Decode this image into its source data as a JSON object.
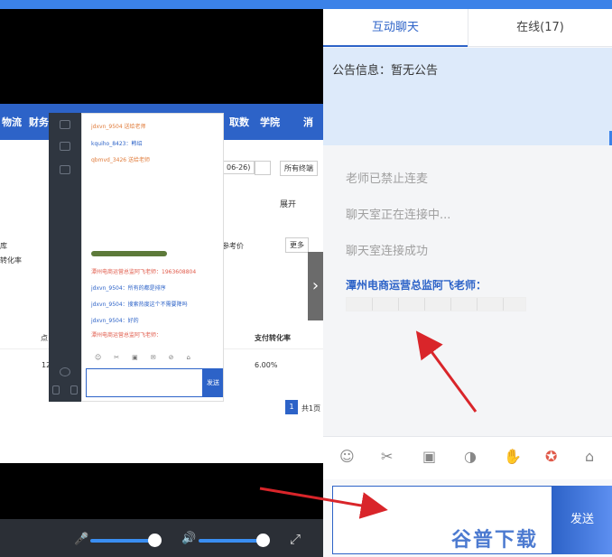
{
  "chat": {
    "tabs": [
      "互动聊天",
      "在线(17)"
    ],
    "notice": "公告信息：暂无公告",
    "system_messages": [
      "老师已禁止连麦",
      "聊天室正在连接中...",
      "聊天室连接成功"
    ],
    "teacher_name": "潭州电商运营总监阿飞老师：",
    "send_label": "发送",
    "tool_icons": [
      "emoji-icon",
      "scissors-icon",
      "image-icon",
      "mic-request-icon",
      "hand-icon",
      "award-icon",
      "gift-icon"
    ]
  },
  "shared_screen": {
    "nav_items": [
      "物流",
      "财务",
      "取数",
      "学院",
      "消"
    ],
    "date_text": "06-26)",
    "terminal_select": "所有终端",
    "expand_label": "展开",
    "more_label": "更多",
    "ref_price_label": "参考价",
    "left_labels": [
      "库",
      "转化率"
    ],
    "col_pay_rate": "支付转化率",
    "col_click": "点",
    "value_12": "12",
    "value_rate": "6.00%",
    "page_num": "1",
    "page_total": "共1页",
    "mini_chat_messages": [
      {
        "text": "jdxvn_9504 送给老师",
        "color": "#e07b3a"
      },
      {
        "text": "kquiho_8423：韩绍",
        "color": "#2d63c8"
      },
      {
        "text": "qbmvd_3426 送给老师",
        "color": "#e07b3a"
      },
      {
        "text": "潭州电商运营总监阿飞老师：1963608804",
        "color": "#e05a4a"
      },
      {
        "text": "jdxvn_9504：所有的都是排序",
        "color": "#2d63c8"
      },
      {
        "text": "jdxvn_9504：搜索热度这个不需要降吗",
        "color": "#2d63c8"
      },
      {
        "text": "jdxvn_9504：好的",
        "color": "#2d63c8"
      },
      {
        "text": "潭州电商运营总监阿飞老师：",
        "color": "#e05a4a"
      }
    ],
    "mini_send": "发送"
  },
  "watermark": "谷普下载",
  "colors": {
    "accent": "#2d63c8",
    "arrow": "#d9252a"
  }
}
